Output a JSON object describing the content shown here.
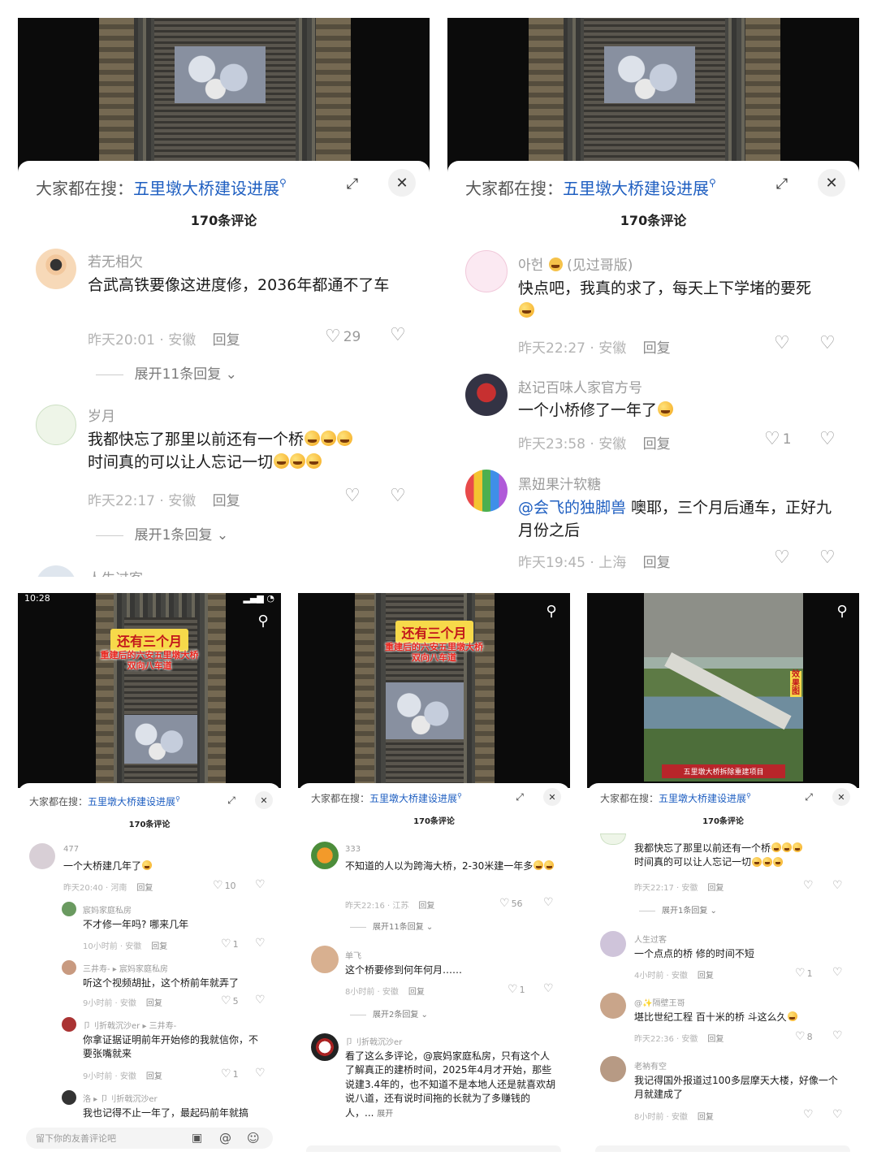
{
  "panels": {
    "p1": {
      "search": {
        "prefix": "大家都在搜：",
        "keyword": "五里墩大桥建设进展"
      },
      "count": "170条评论",
      "comments": [
        {
          "name": "若无相欠",
          "text": "合武高铁要像这进度修，2036年都通不了车",
          "time": "昨天20:01 · 安徽",
          "reply": "回复",
          "likes": "29",
          "expand": "展开11条回复"
        },
        {
          "name": "岁月",
          "text1": "我都快忘了那里以前还有一个桥",
          "text2": "时间真的可以让人忘记一切",
          "time": "昨天22:17 · 安徽",
          "reply": "回复",
          "likes": "",
          "expand": "展开1条回复"
        }
      ],
      "partial_name": "人生过客"
    },
    "p2": {
      "search": {
        "prefix": "大家都在搜：",
        "keyword": "五里墩大桥建设进展"
      },
      "count": "170条评论",
      "comments": [
        {
          "name": "아헌",
          "name_suffix": "(见过哥版)",
          "text": "快点吧，我真的求了，每天上下学堵的要死",
          "time": "昨天22:27 · 安徽",
          "reply": "回复",
          "likes": ""
        },
        {
          "name": "赵记百味人家官方号",
          "text": "一个小桥修了一年了",
          "time": "昨天23:58 · 安徽",
          "reply": "回复",
          "likes": "1"
        },
        {
          "name": "黑妞果汁软糖",
          "mention": "@会飞的独脚兽",
          "text": " 噢耶，三个月后通车，正好九月份之后",
          "time": "昨天19:45 · 上海",
          "reply": "回复",
          "likes": ""
        }
      ]
    },
    "p3": {
      "status_time": "10:28",
      "overlay_title": "还有三个月",
      "overlay_sub1": "重建后的六安五里墩大桥",
      "overlay_sub2": "双向八车道",
      "search": {
        "prefix": "大家都在搜：",
        "keyword": "五里墩大桥建设进展"
      },
      "count": "170条评论",
      "comments": [
        {
          "name": "477",
          "text": "一个大桥建几年了",
          "time": "昨天20:40 · 河南",
          "reply": "回复",
          "likes": "10"
        },
        {
          "name": "宸妈家庭私房",
          "text": "不才修一年吗? 哪来几年",
          "time": "10小时前 · 安徽",
          "reply": "回复",
          "likes": "1"
        },
        {
          "name": "三井寿- ▸ 宸妈家庭私房",
          "text": "听这个视频胡扯，这个桥前年就弄了",
          "time": "9小时前 · 安徽",
          "reply": "回复",
          "likes": "5"
        },
        {
          "name": "卩刂折戟沉沙er ▸ 三井寿-",
          "text": "你拿证据证明前年开始修的我就信你，不要张嘴就来",
          "time": "9小时前 · 安徽",
          "reply": "回复",
          "likes": "1"
        },
        {
          "name": "洛 ▸ 卩刂折戟沉沙er",
          "text": "我也记得不止一年了，最起码前年就搞"
        }
      ],
      "input_placeholder": "留下你的友善评论吧"
    },
    "p4": {
      "overlay_title": "还有三个月",
      "overlay_sub1": "重建后的六安五里墩大桥",
      "overlay_sub2": "双向八车道",
      "search": {
        "prefix": "大家都在搜：",
        "keyword": "五里墩大桥建设进展"
      },
      "count": "170条评论",
      "comments": [
        {
          "name": "333",
          "text": "不知道的人以为跨海大桥，2-30米建一年多",
          "time": "昨天22:16 · 江苏",
          "reply": "回复",
          "likes": "56",
          "expand": "展开11条回复"
        },
        {
          "name": "单飞",
          "text": "这个桥要修到何年何月……",
          "time": "8小时前 · 安徽",
          "reply": "回复",
          "likes": "1",
          "expand": "展开2条回复"
        },
        {
          "name": "卩刂折戟沉沙er",
          "text": "看了这么多评论，@宸妈家庭私房，只有这个人了解真正的建桥时间，2025年4月才开始，那些说建3.4年的，也不知道不是本地人还是就喜欢胡说八道，还有说时间拖的长就为了多赚钱的人，...",
          "more": "展开"
        }
      ]
    },
    "p5": {
      "image_caption": "五里墩大桥拆除重建项目",
      "side_caption": "效果图",
      "search": {
        "prefix": "大家都在搜：",
        "keyword": "五里墩大桥建设进展"
      },
      "count": "170条评论",
      "comments": [
        {
          "text1": "我都快忘了那里以前还有一个桥",
          "text2": "时间真的可以让人忘记一切",
          "time": "昨天22:17 · 安徽",
          "reply": "回复",
          "likes": "",
          "expand": "展开1条回复"
        },
        {
          "name": "人生过客",
          "text": "一个点点的桥 修的时间不短",
          "time": "4小时前 · 安徽",
          "reply": "回复",
          "likes": "1"
        },
        {
          "name": "@✨隔壁王哥",
          "text": "堪比世纪工程 百十米的桥 斗这么久",
          "time": "昨天22:36 · 安徽",
          "reply": "回复",
          "likes": "8"
        },
        {
          "name": "老衲有空",
          "text": "我记得国外报道过100多层摩天大楼，好像一个月就建成了",
          "time": "8小时前 · 安徽",
          "reply": "回复",
          "likes": ""
        }
      ]
    }
  },
  "colors": {
    "keyword": "#1f5fc1",
    "overlay_bg": "#f7d94a",
    "overlay_text": "#c2151b"
  }
}
